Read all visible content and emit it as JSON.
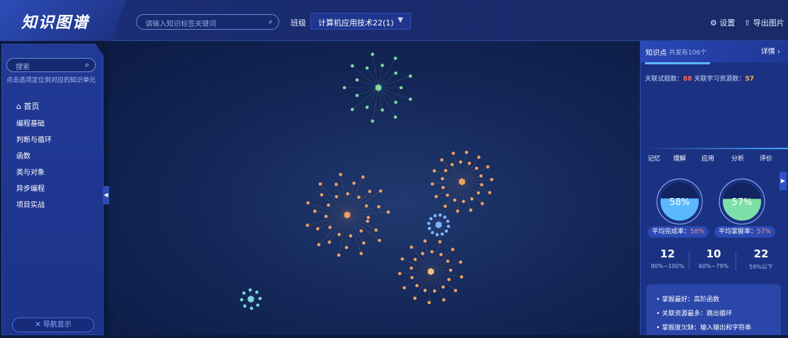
{
  "header": {
    "logo_text": "知识图谱",
    "search_placeholder": "请输入知识标签关键词",
    "class_label": "班级",
    "class_value": "计算机应用技术22(1)",
    "settings_label": "设置",
    "export_label": "导出图片"
  },
  "sidebar": {
    "search_placeholder": "搜索",
    "hint": "点击选项定位到对应的知识单元",
    "home_label": "首页",
    "items": [
      "编程基础",
      "判断与循环",
      "函数",
      "类与对象",
      "异步编程",
      "项目实战"
    ],
    "nav_toggle_label": "导航显示"
  },
  "right_panel": {
    "title": "知识点",
    "subtitle": "共发布106个",
    "detail_label": "详情",
    "stats": {
      "questions_label": "关联试题数：",
      "questions_value": "88",
      "resources_label": "关联学习资源数：",
      "resources_value": "57"
    },
    "bloom_levels": [
      "记忆",
      "理解",
      "应用",
      "分析",
      "评价"
    ],
    "gauges": [
      {
        "percent_text": "58%",
        "label": "平均完成率：",
        "value": "58%",
        "fill": 0.58,
        "color": "#5ab8ff"
      },
      {
        "percent_text": "57%",
        "label": "平均掌握率：",
        "value": "57%",
        "fill": 0.57,
        "color": "#7ee0a8"
      }
    ],
    "distribution": [
      {
        "count": "12",
        "range": "80%~100%"
      },
      {
        "count": "10",
        "range": "60%~79%"
      },
      {
        "count": "22",
        "range": "59%以下"
      }
    ],
    "summary": [
      "掌握最好：高阶函数",
      "关联资源最多：跳出循环",
      "掌握度欠缺：输入输出和字符串"
    ]
  },
  "colors": {
    "accent": "#5fb7ff",
    "cluster_green": "#7fd9a0",
    "cluster_orange": "#f0a060",
    "cluster_blue": "#7fb3ff",
    "cluster_teal": "#7ad8d8"
  }
}
